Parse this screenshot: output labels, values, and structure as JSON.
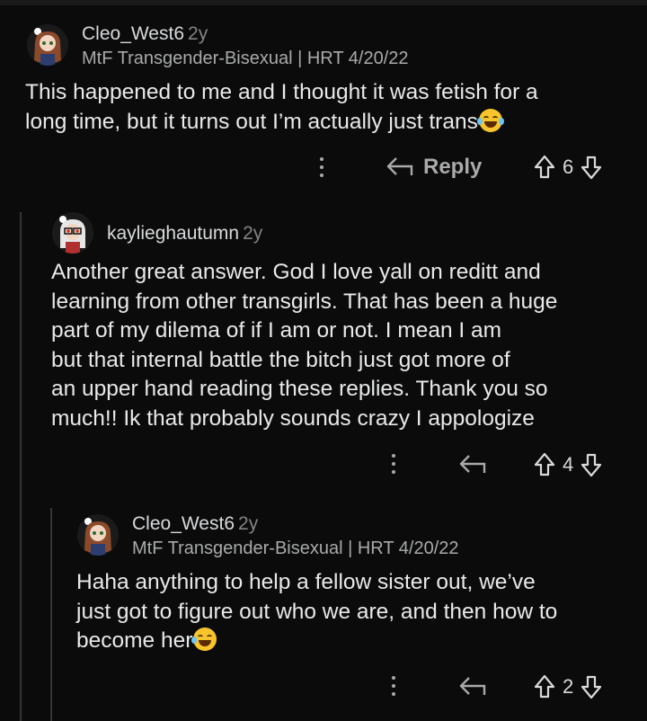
{
  "comments": [
    {
      "username": "Cleo_West6",
      "age": "2y",
      "flair": "MtF Transgender-Bisexual | HRT 4/20/22",
      "lines": [
        "This happened to me and I thought it was fetish for a",
        "long time, but it turns out I’m actually just trans"
      ],
      "reply_label": "Reply",
      "score": "6",
      "emoji": "laughing-tears"
    },
    {
      "username": "kaylieghautumn",
      "age": "2y",
      "flair": "",
      "lines": [
        "Another great answer. God I love yall on reditt and",
        "learning from other transgirls. That has been a huge",
        "part of my dilema of if I am or not. I mean I am",
        "but that internal battle the bitch just got more of",
        "an upper hand reading these replies. Thank you so",
        "much!! Ik that probably sounds crazy I appologize"
      ],
      "score": "4"
    },
    {
      "username": "Cleo_West6",
      "age": "2y",
      "flair": "MtF Transgender-Bisexual | HRT 4/20/22",
      "lines": [
        "Haha anything to help a fellow sister out, we’ve",
        "just got to figure out who we are, and then how to",
        "become her"
      ],
      "score": "2",
      "emoji": "grinning-sweat"
    }
  ],
  "icons": {
    "more": "kebab-icon",
    "reply": "reply-arrow-icon",
    "upvote": "upvote-arrow-icon",
    "downvote": "downvote-arrow-icon"
  },
  "colors": {
    "background": "#0b0b0b",
    "text": "#d7dadc",
    "muted": "#a8aaab",
    "thread_line": "#343536"
  }
}
